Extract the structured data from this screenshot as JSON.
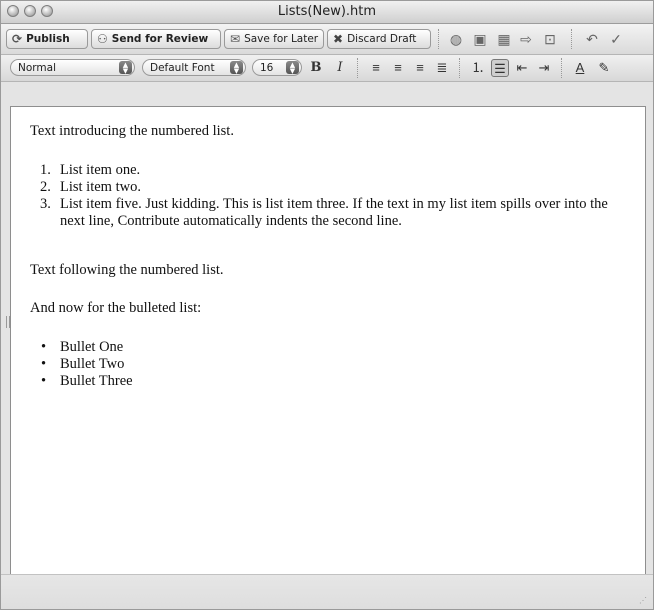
{
  "window": {
    "title": "Lists(New).htm"
  },
  "toolbar": {
    "publish": "Publish",
    "send_for_review": "Send for Review",
    "save_for_later": "Save for Later",
    "discard_draft": "Discard Draft",
    "icons": [
      "insert-web-icon",
      "insert-image-icon",
      "insert-table-icon",
      "insert-link-icon",
      "page-properties-icon",
      "undo-icon",
      "spell-check-icon"
    ]
  },
  "format_bar": {
    "paragraph_style": "Normal",
    "font": "Default Font",
    "font_size": "16",
    "bold": "B",
    "italic": "I",
    "text_color": "A"
  },
  "document": {
    "intro": "Text introducing the numbered list.",
    "numbered_list": [
      {
        "num": "1.",
        "text": "List item one."
      },
      {
        "num": "2.",
        "text": "List item two."
      },
      {
        "num": "3.",
        "text": "List item five. Just kidding. This is list item three. If the text in my list item spills over into the next line, Contribute automatically indents the second line."
      }
    ],
    "after_numbered": "Text following the numbered list.",
    "bullet_intro": "And now for the bulleted list:",
    "bullet_list": [
      "Bullet One",
      "Bullet Two",
      "Bullet Three"
    ]
  }
}
